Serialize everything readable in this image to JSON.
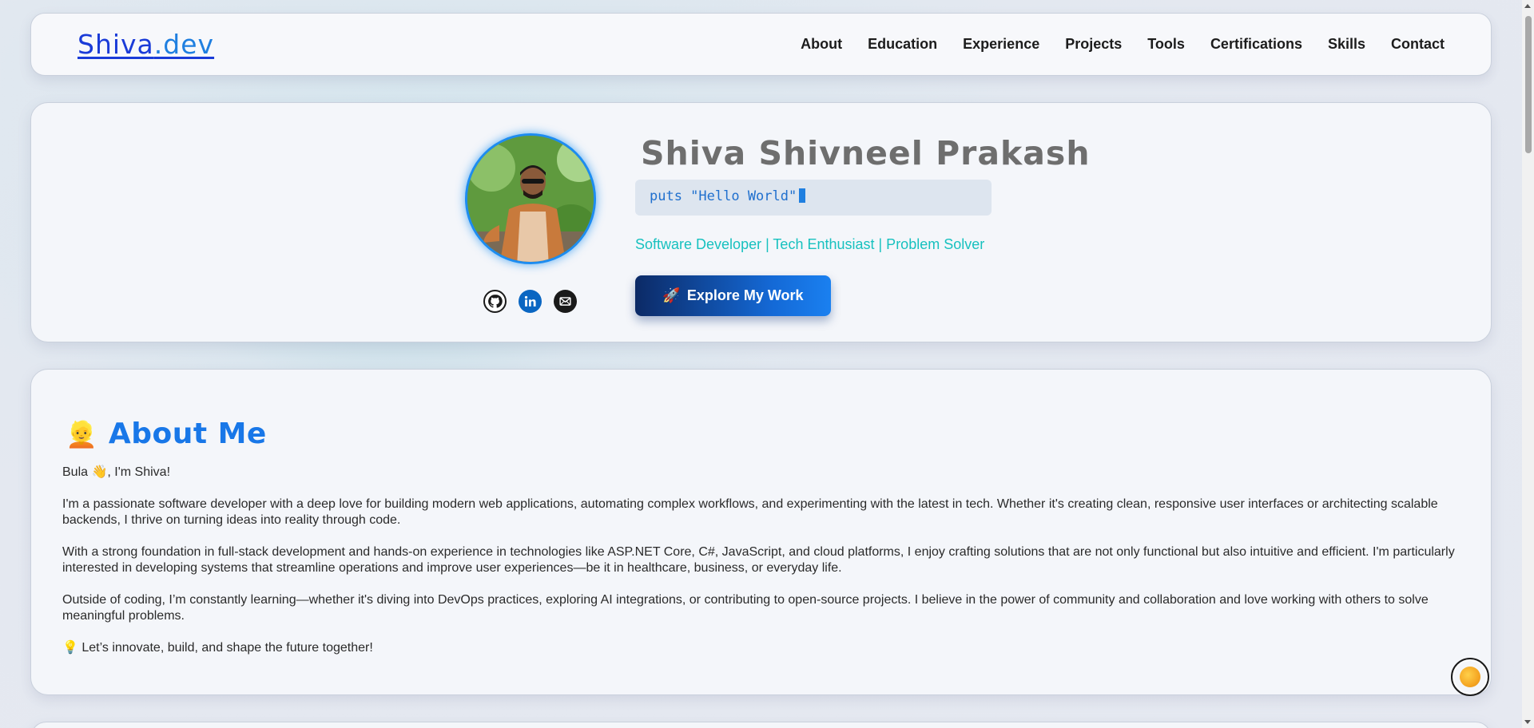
{
  "nav": {
    "logo_main": "Shiva",
    "logo_dot": ".dev",
    "links": [
      "About",
      "Education",
      "Experience",
      "Projects",
      "Tools",
      "Certifications",
      "Skills",
      "Contact"
    ]
  },
  "hero": {
    "name": "Shiva Shivneel Prakash",
    "code": "puts \"Hello World\"",
    "tagline": "Software Developer | Tech Enthusiast | Problem Solver",
    "cta_icon": "🚀",
    "cta_label": "Explore My Work",
    "socials": [
      "github-icon",
      "linkedin-icon",
      "email-icon"
    ]
  },
  "about": {
    "emoji": "👱",
    "title": "About Me",
    "paragraphs": [
      "Bula 👋, I'm Shiva!",
      "I'm a passionate software developer with a deep love for building modern web applications, automating complex workflows, and experimenting with the latest in tech. Whether it's creating clean, responsive user interfaces or architecting scalable backends, I thrive on turning ideas into reality through code.",
      "With a strong foundation in full-stack development and hands-on experience in technologies like ASP.NET Core, C#, JavaScript, and cloud platforms, I enjoy crafting solutions that are not only functional but also intuitive and efficient. I'm particularly interested in developing systems that streamline operations and improve user experiences—be it in healthcare, business, or everyday life.",
      "Outside of coding, I’m constantly learning—whether it's diving into DevOps practices, exploring AI integrations, or contributing to open-source projects. I believe in the power of community and collaboration and love working with others to solve meaningful problems.",
      "💡 Let’s innovate, build, and shape the future together!"
    ]
  },
  "theme_toggle": {
    "icon": "sun-icon"
  },
  "colors": {
    "accent": "#1877e8",
    "tagline": "#17c1bf",
    "logo": "#1a3bd8"
  }
}
